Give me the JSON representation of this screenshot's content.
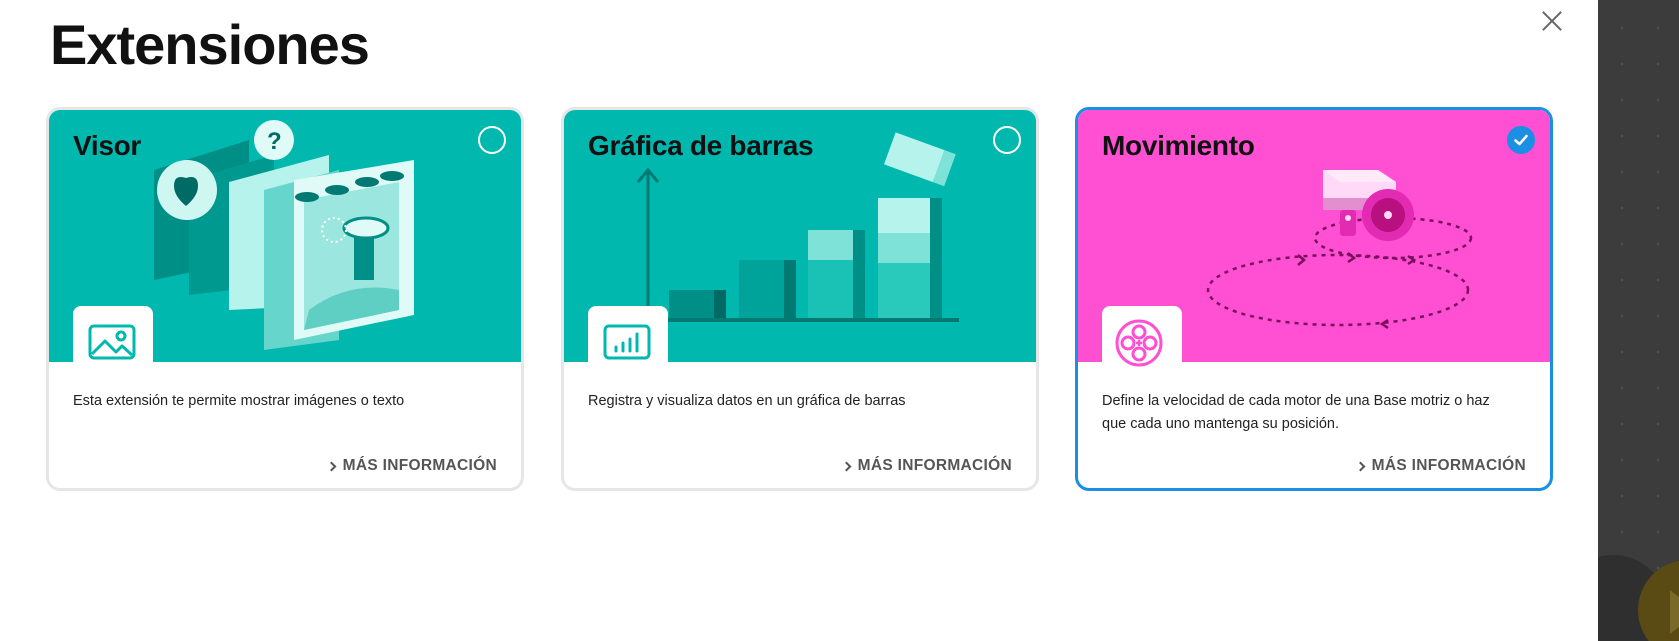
{
  "modal": {
    "title": "Extensiones",
    "close_label": "close"
  },
  "colors": {
    "teal": "#00b8ad",
    "magenta": "#ff4fd2",
    "selected_border": "#1a8fe3"
  },
  "cards": [
    {
      "title": "Visor",
      "description": "Esta extensión te permite mostrar imágenes o texto",
      "more_label": "MÁS INFORMACIÓN",
      "icon": "image-icon",
      "selected": false
    },
    {
      "title": "Gráfica de barras",
      "description": "Registra y visualiza datos en un gráfica de barras",
      "more_label": "MÁS INFORMACIÓN",
      "icon": "bar-chart-icon",
      "selected": false
    },
    {
      "title": "Movimiento",
      "description": "Define la velocidad de cada motor de una Base motriz o haz que cada uno mantenga su posición.",
      "more_label": "MÁS INFORMACIÓN",
      "icon": "motor-icon",
      "selected": true
    }
  ]
}
